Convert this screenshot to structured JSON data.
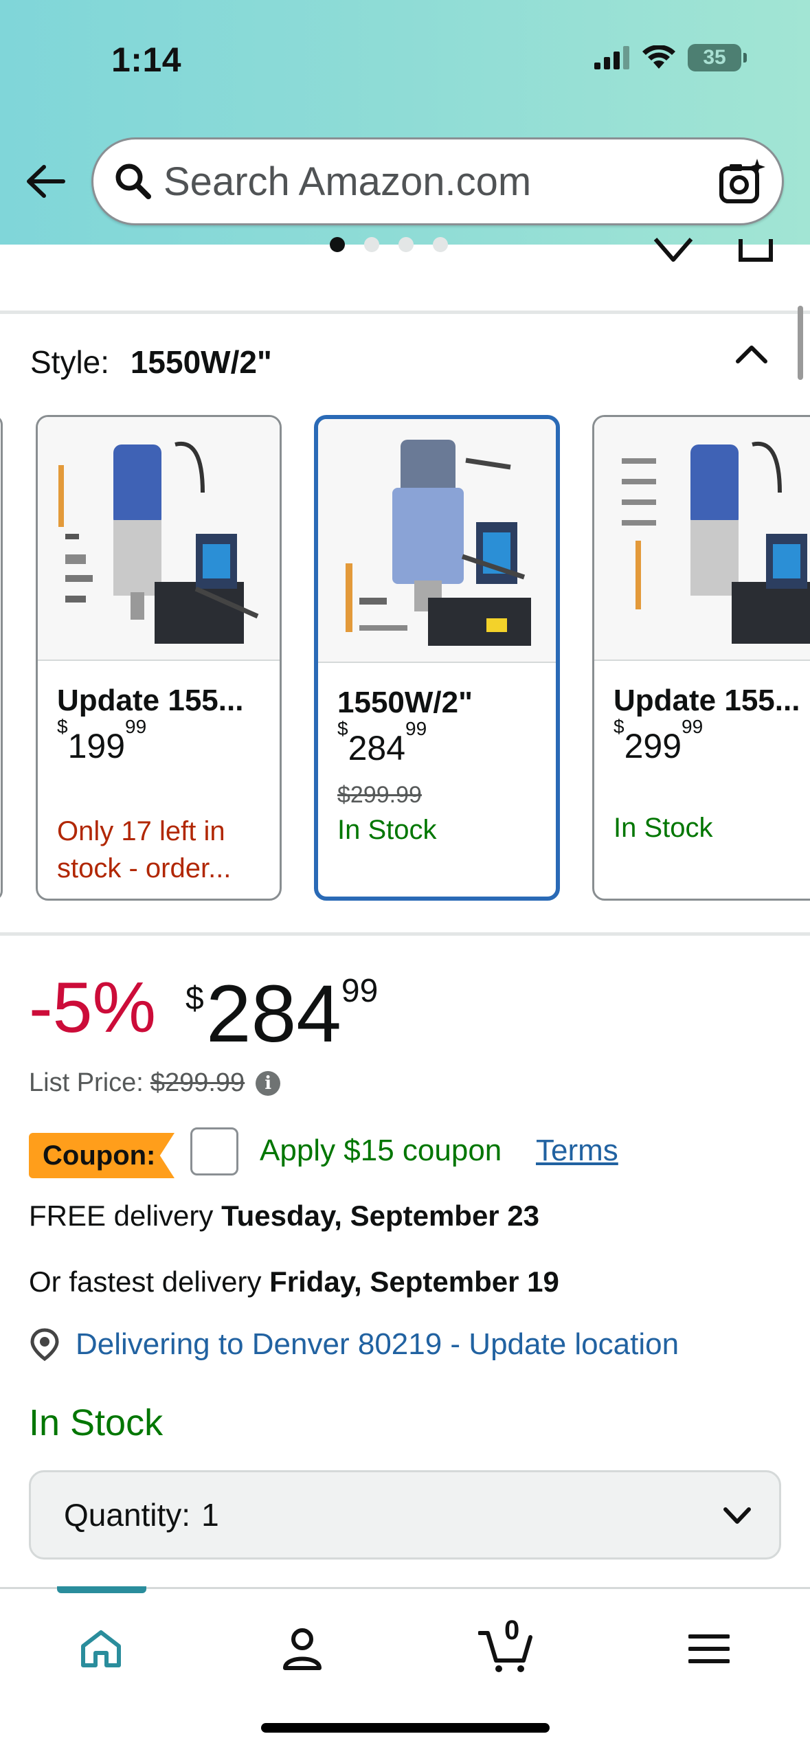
{
  "status_bar": {
    "time": "1:14",
    "battery": "35"
  },
  "search": {
    "placeholder": "Search Amazon.com"
  },
  "style_selector": {
    "label": "Style:",
    "selected": "1550W/2\"",
    "variants": [
      {
        "name": "Update 155...",
        "price_whole": "199",
        "price_cents": "99",
        "currency": "$",
        "availability": "Only 17 left in stock - order...",
        "availability_type": "low"
      },
      {
        "name": "1550W/2\"",
        "price_whole": "284",
        "price_cents": "99",
        "currency": "$",
        "list_price": "$299.99",
        "availability": "In Stock",
        "availability_type": "in_stock",
        "selected": true
      },
      {
        "name": "Update 155...",
        "price_whole": "299",
        "price_cents": "99",
        "currency": "$",
        "availability": "In Stock",
        "availability_type": "in_stock"
      }
    ]
  },
  "price": {
    "savings": "-5%",
    "currency": "$",
    "whole": "284",
    "cents": "99",
    "list_label": "List Price:",
    "list_value": "$299.99"
  },
  "coupon": {
    "badge": "Coupon:",
    "text": "Apply $15 coupon",
    "terms": "Terms"
  },
  "delivery": {
    "free_prefix": "FREE delivery",
    "free_date": "Tuesday, September 23",
    "fast_prefix": "Or fastest delivery",
    "fast_date": "Friday, September 19",
    "location": "Delivering to Denver 80219 - Update location"
  },
  "availability": "In Stock",
  "quantity": {
    "label": "Quantity:",
    "value": "1"
  },
  "bottom_nav": {
    "cart_count": "0"
  },
  "colors": {
    "accent": "#2a6ab6",
    "price_red": "#cc0c39",
    "green": "#007600",
    "link": "#2162a1",
    "coupon_orange": "#ff9e1b"
  }
}
